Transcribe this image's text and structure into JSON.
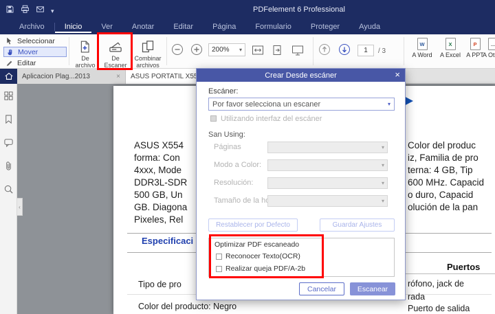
{
  "colors": {
    "titlebar": "#1d2c62",
    "accent_blue": "#3b52c0",
    "dialog_header": "#4857a6",
    "scan_button": "#8792d8",
    "annotation_red": "#ff0000",
    "annotation_arrow_blue": "#1251b5",
    "doc_heading_blue": "#1f3fae"
  },
  "glyphs": {
    "close": "×",
    "caret_down": "▾",
    "chevron_left": "‹"
  },
  "titlebar": {
    "title": "PDFelement 6 Professional"
  },
  "menubar": {
    "items": [
      "Archivo",
      "Inicio",
      "Ver",
      "Anotar",
      "Editar",
      "Página",
      "Formulario",
      "Proteger",
      "Ayuda"
    ],
    "active_item": "Inicio"
  },
  "toolbar": {
    "select": "Seleccionar",
    "move": "Mover",
    "edit": "Editar",
    "from_file": "De archivo",
    "from_scanner": "De Escaner",
    "combine": "Combinar archivos",
    "zoom_value": "200%",
    "page_current": "1",
    "page_total": "/ 3",
    "convert": [
      {
        "label": "A Word",
        "letter": "W"
      },
      {
        "label": "A Excel",
        "letter": "X"
      },
      {
        "label": "A PPT",
        "letter": "P"
      },
      {
        "label": "A Otros",
        "letter": "..."
      }
    ]
  },
  "tabs": [
    {
      "label": "Aplicacion Plag...2013"
    },
    {
      "label": "ASUS PORTATIL X55..."
    }
  ],
  "document": {
    "left_lines": [
      "ASUS X554",
      "forma: Con",
      "4xxx, Mode",
      "DDR3L-SDR",
      "500 GB, Un",
      "GB. Diagona",
      "Pixeles, Rel"
    ],
    "right_lines": [
      "Color del produc",
      "iz, Familia de pro",
      "terna: 4 GB, Tip",
      "600 MHz. Capacid",
      "o duro, Capacid",
      "olución de la pan"
    ],
    "section_heading": "Especificaci",
    "spec_row1": "Tipo de pro",
    "spec_row2": "Color del producto: Negro",
    "ports_heading": "Puertos",
    "ports_row1": "rófono, jack de",
    "ports_row2": "rada",
    "ports_row3": "Puerto de salida"
  },
  "dialog": {
    "title": "Crear Desde escáner",
    "scanner_label": "Escáner:",
    "scanner_value": "Por favor selecciona un escaner",
    "use_interface_label": "Utilizando interfaz del escáner",
    "scan_using_label": "San Using:",
    "fields": [
      {
        "label": "Páginas"
      },
      {
        "label": "Modo a Color:"
      },
      {
        "label": "Resolución:"
      },
      {
        "label": "Tamaño de la hoja:"
      }
    ],
    "reset_button": "Restablecer por Defecto",
    "save_button": "Guardar Ajustes",
    "optimize_group_label": "Optimizar PDF escaneado",
    "ocr_checkbox_label": "Reconocer Texto(OCR)",
    "pdfa_checkbox_label": "Realizar queja PDF/A-2b",
    "cancel_button": "Cancelar",
    "scan_button": "Escanear"
  }
}
